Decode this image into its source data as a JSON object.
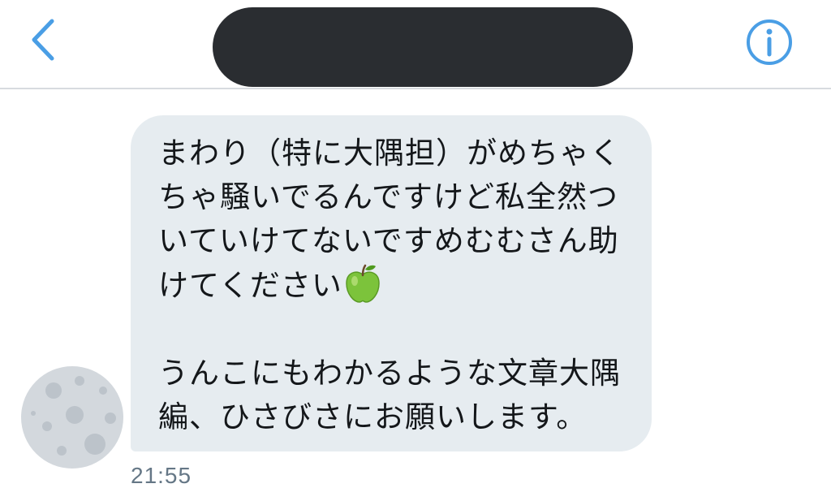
{
  "header": {
    "back_icon": "chevron-left-icon",
    "info_icon": "info-circle-icon",
    "title_redacted_color": "#2a2d31",
    "accent_color": "#4a9ee5"
  },
  "message": {
    "lines_paragraph1": [
      "まわり（特に大隅担）がめちゃく",
      "ちゃ騒いでるんですけど私全然つ",
      "いていけてないですめむむさん助",
      "けてください"
    ],
    "emoji": "green-apple-icon",
    "lines_paragraph2": [
      "うんこにもわかるような文章大隅",
      "編、ひさびさにお願いします。"
    ],
    "timestamp": "21:55",
    "bubble_color": "#e6ecf0"
  },
  "sender": {
    "avatar_icon": "moon-avatar-icon"
  }
}
